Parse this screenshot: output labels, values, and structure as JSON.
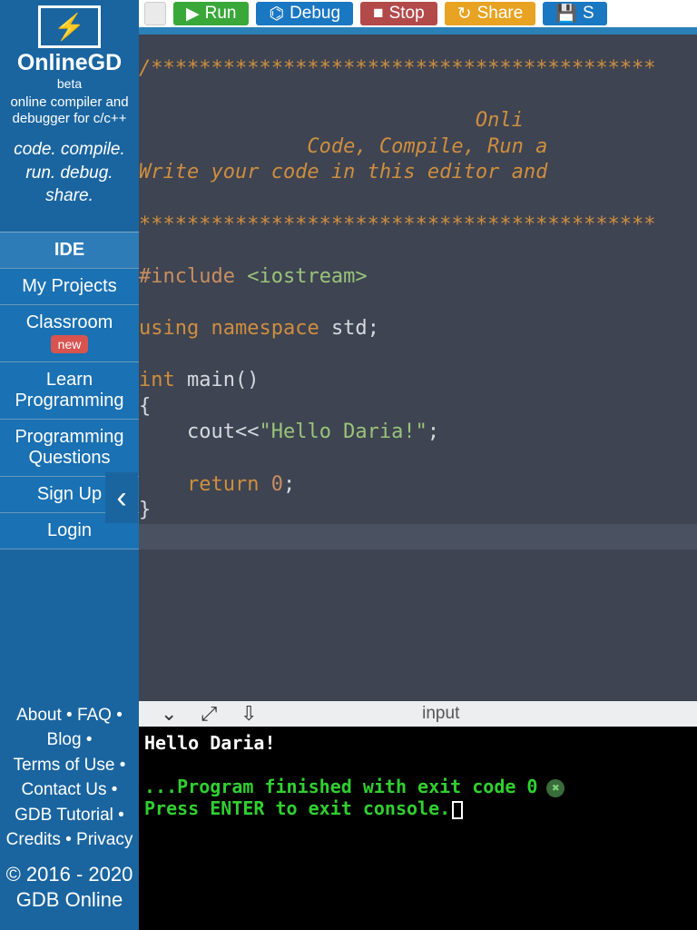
{
  "brand": {
    "name": "OnlineGD",
    "badge": "beta",
    "tagline": "online compiler and debugger for c/c++",
    "motto": "code. compile. run. debug. share."
  },
  "nav": {
    "ide": "IDE",
    "myprojects": "My Projects",
    "classroom": "Classroom",
    "classroom_badge": "new",
    "learn": "Learn Programming",
    "pq": "Programming Questions",
    "signup": "Sign Up",
    "login": "Login"
  },
  "footer_links": {
    "about": "About",
    "faq": "FAQ",
    "blog": "Blog",
    "terms": "Terms of Use",
    "contact": "Contact Us",
    "gdbtut": "GDB Tutorial",
    "credits": "Credits",
    "privacy": "Privacy"
  },
  "copyright": "© 2016 - 2020 GDB Online",
  "toolbar": {
    "run": "Run",
    "debug": "Debug",
    "stop": "Stop",
    "share": "Share",
    "save_prefix": "S"
  },
  "collapse_glyph": "‹",
  "code": {
    "c1": "/******************************************",
    "c2_a": "                            Onli",
    "c2_b": "              Code, Compile, Run a",
    "c2_c": "Write your code in this editor and ",
    "c3": "*******************************************",
    "inc_kw": "#include ",
    "inc_val": "<iostream>",
    "using_kw": "using ",
    "ns_kw": "namespace ",
    "std": "std",
    "semi": ";",
    "int": "int ",
    "main": "main()",
    "brace_o": "{",
    "brace_c": "}",
    "cout": "    cout",
    "lsh": "<<",
    "hello": "\"Hello Daria!\"",
    "ret_kw": "    return ",
    "zero": "0"
  },
  "term_header": {
    "label": "input"
  },
  "terminal": {
    "line1": "Hello Daria!",
    "line2": "...Program finished with exit code 0",
    "line3": "Press ENTER to exit console."
  }
}
